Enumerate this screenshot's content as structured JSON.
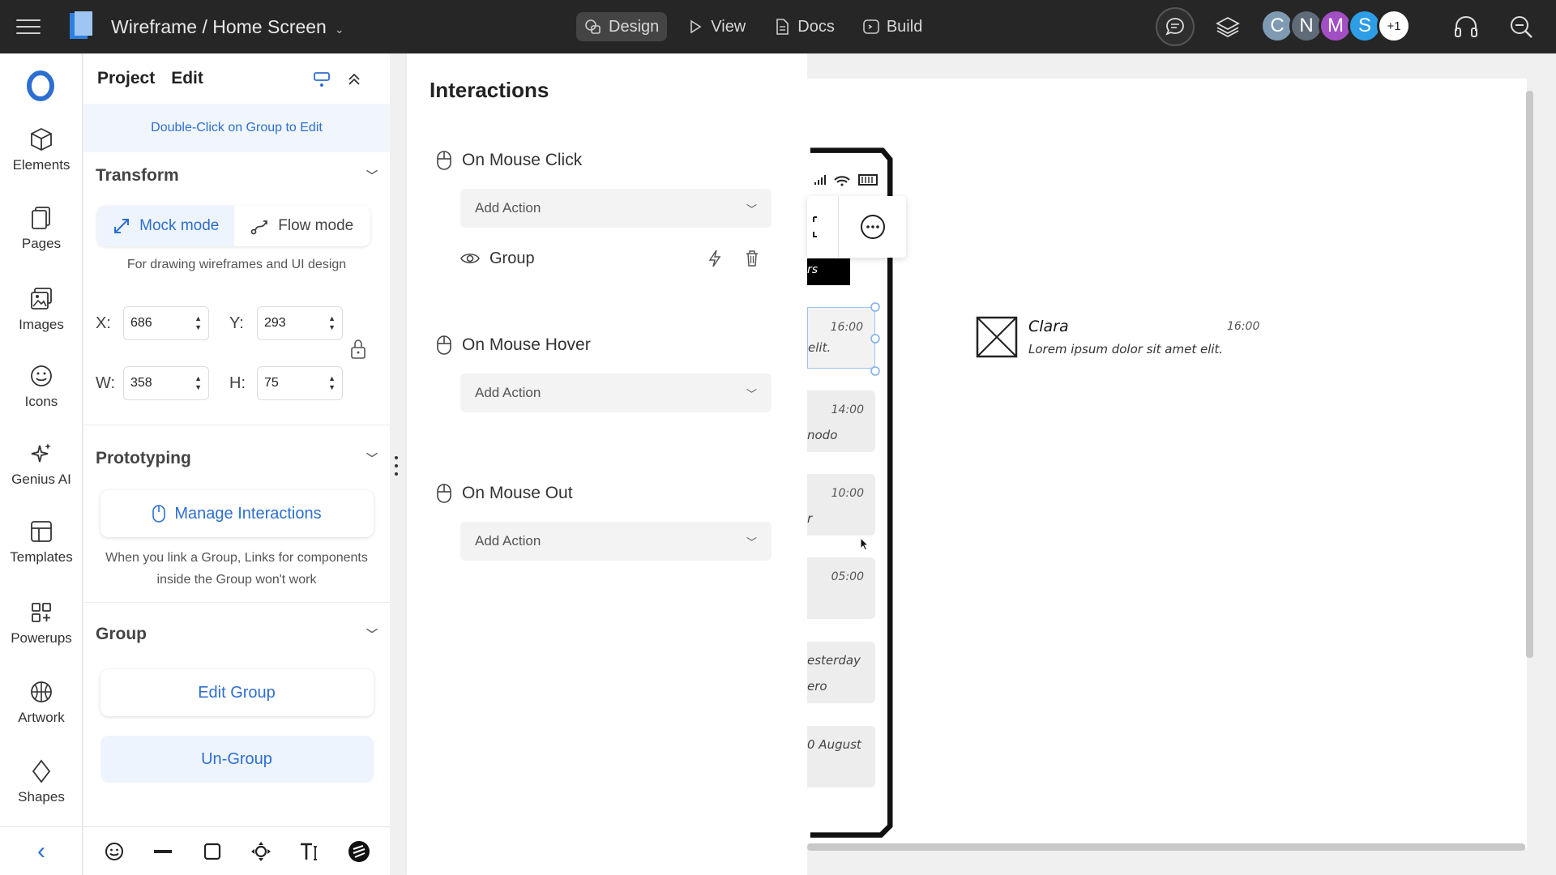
{
  "topbar": {
    "title": "Wireframe / Home Screen",
    "modes": [
      {
        "label": "Design",
        "icon": "shapes-icon",
        "active": true
      },
      {
        "label": "View",
        "icon": "play-icon",
        "active": false
      },
      {
        "label": "Docs",
        "icon": "document-icon",
        "active": false
      },
      {
        "label": "Build",
        "icon": "code-icon",
        "active": false
      }
    ],
    "avatars": [
      {
        "initial": "C",
        "color": "#7f9bb3"
      },
      {
        "initial": "N",
        "color": "#5f6b78"
      },
      {
        "initial": "M",
        "color": "#a34fc4"
      },
      {
        "initial": "S",
        "color": "#2d9ee6"
      }
    ],
    "extra_collaborators": "+1"
  },
  "rail": {
    "items": [
      {
        "label": "Elements",
        "icon": "cube-icon"
      },
      {
        "label": "Pages",
        "icon": "pages-icon"
      },
      {
        "label": "Images",
        "icon": "images-icon"
      },
      {
        "label": "Icons",
        "icon": "smiley-icon"
      },
      {
        "label": "Genius AI",
        "icon": "sparkle-icon"
      },
      {
        "label": "Templates",
        "icon": "templates-icon"
      },
      {
        "label": "Powerups",
        "icon": "powerups-icon"
      },
      {
        "label": "Artwork",
        "icon": "basketball-icon"
      },
      {
        "label": "Shapes",
        "icon": "diamond-icon"
      }
    ]
  },
  "props": {
    "tabs": [
      "Project",
      "Edit"
    ],
    "hint": "Double-Click on Group to Edit",
    "transform": {
      "title": "Transform",
      "mock_mode": "Mock mode",
      "flow_mode": "Flow mode",
      "note": "For drawing wireframes and UI design",
      "x_label": "X:",
      "x": "686",
      "y_label": "Y:",
      "y": "293",
      "w_label": "W:",
      "w": "358",
      "h_label": "H:",
      "h": "75"
    },
    "prototyping": {
      "title": "Prototyping",
      "manage_label": "Manage Interactions",
      "note": "When you link a Group, Links for components inside the Group won't work"
    },
    "group": {
      "title": "Group",
      "edit_label": "Edit Group",
      "ungroup_label": "Un-Group"
    }
  },
  "interactions": {
    "title": "Interactions",
    "events": [
      {
        "label": "On Mouse Click",
        "action_placeholder": "Add Action"
      },
      {
        "label": "On Mouse Hover",
        "action_placeholder": "Add Action"
      },
      {
        "label": "On Mouse Out",
        "action_placeholder": "Add Action"
      }
    ],
    "existing_action": "Group"
  },
  "canvas": {
    "message": {
      "name": "Clara",
      "time": "16:00",
      "body": "Lorem ipsum dolor sit amet elit."
    },
    "list_items": [
      {
        "time": "16:00",
        "snippet": "elit."
      },
      {
        "time": "14:00",
        "snippet": "nodo"
      },
      {
        "time": "10:00",
        "snippet": "r"
      },
      {
        "time": "05:00",
        "snippet": ""
      },
      {
        "time": "",
        "snippet": "esterday"
      },
      {
        "time": "",
        "snippet": "ero"
      },
      {
        "time": "",
        "snippet": "0 August"
      }
    ],
    "header_fragment": "rs"
  }
}
